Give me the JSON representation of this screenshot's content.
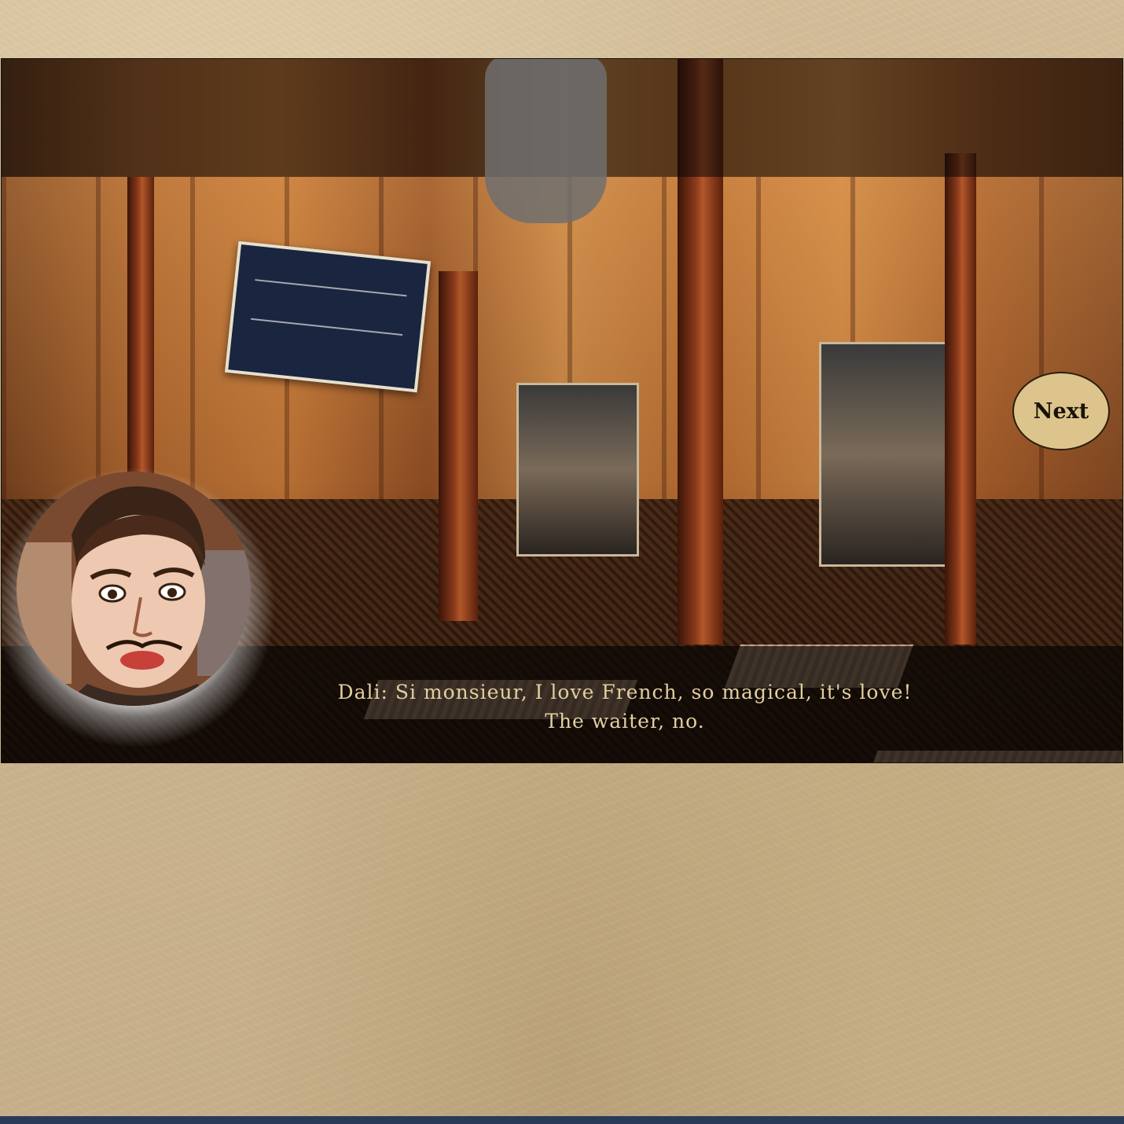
{
  "dialog": {
    "line1": "Dali: Si monsieur, I love French, so magical, it's love!",
    "line2": "The waiter, no."
  },
  "controls": {
    "next_label": "Next"
  },
  "speaker": {
    "portrait_icon": "character-portrait"
  },
  "colors": {
    "dialog_text": "#e2cfa1",
    "next_button_bg": "#dcc48c",
    "parchment": "#cdb792"
  }
}
